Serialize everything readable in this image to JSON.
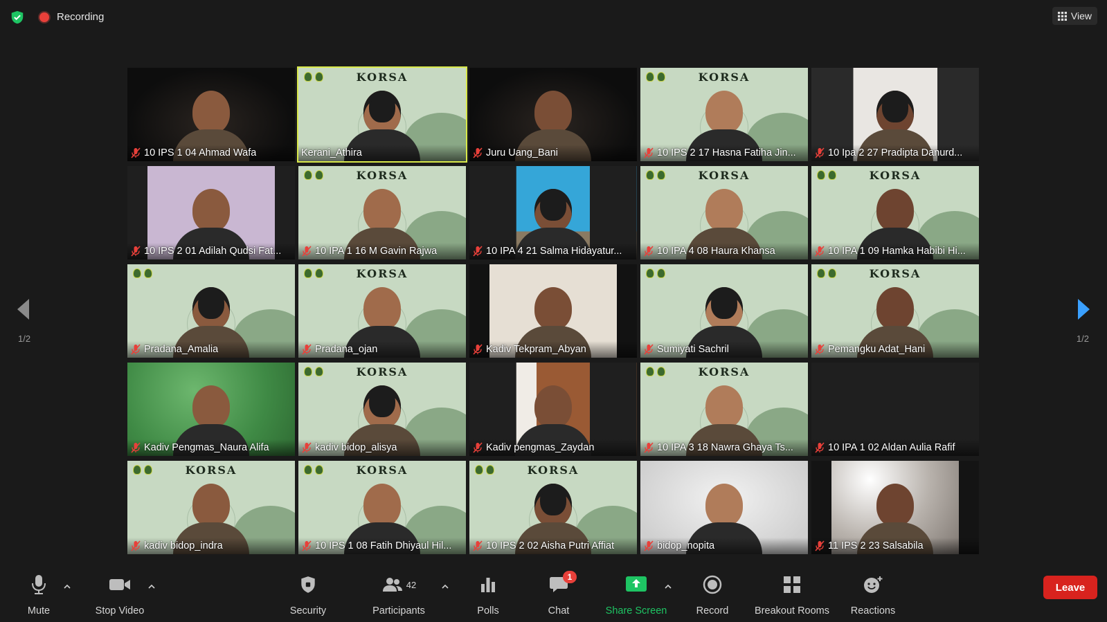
{
  "top": {
    "recording_label": "Recording",
    "view_label": "View"
  },
  "colors": {
    "accent_green": "#1ec463",
    "active_speaker": "#d8e84a",
    "leave_red": "#d8231e",
    "muted_red": "#e8403a"
  },
  "pager": {
    "left": "1/2",
    "right": "1/2"
  },
  "participants": [
    {
      "name": "10 IPS 1 04 Ahmad Wafa",
      "muted": true,
      "bg": "dark"
    },
    {
      "name": "Kerani_Athira",
      "muted": false,
      "bg": "korsa",
      "active": true,
      "banner": "KORSA"
    },
    {
      "name": "Juru Uang_Bani",
      "muted": true,
      "bg": "dark"
    },
    {
      "name": "10 IPS 2 17 Hasna Fatiha Jin...",
      "muted": true,
      "bg": "korsa",
      "banner": "KORSA"
    },
    {
      "name": "10 Ipa 2 27 Pradipta Danurd...",
      "muted": true,
      "bg": "room"
    },
    {
      "name": "10 IPS 2 01 Adilah Qudsi Fat...",
      "muted": true,
      "bg": "purple"
    },
    {
      "name": "10 IPA 1 16 M Gavin Rajwa",
      "muted": true,
      "bg": "korsa",
      "banner": "KORSA"
    },
    {
      "name": "10 IPA 4 21 Salma Hidayatur...",
      "muted": true,
      "bg": "blue"
    },
    {
      "name": "10 IPA 4 08 Haura Khansa",
      "muted": true,
      "bg": "korsa",
      "banner": "KORSA"
    },
    {
      "name": "10 IPA 1 09 Hamka Habibi Hi...",
      "muted": true,
      "bg": "korsa",
      "banner": "KORSA"
    },
    {
      "name": "Pradana_Amalia",
      "muted": true,
      "bg": "korsa",
      "banner": ""
    },
    {
      "name": "Pradana_ojan",
      "muted": true,
      "bg": "korsa",
      "banner": "KORSA"
    },
    {
      "name": "Kadiv Tekpram_Abyan",
      "muted": true,
      "bg": "wall"
    },
    {
      "name": "Sumiyati Sachril",
      "muted": true,
      "bg": "korsa",
      "banner": ""
    },
    {
      "name": "Pemangku Adat_Hani",
      "muted": true,
      "bg": "korsa",
      "banner": "KORSA"
    },
    {
      "name": "Kadiv Pengmas_Naura Alifa",
      "muted": true,
      "bg": "green"
    },
    {
      "name": "kadiv bidop_alisya",
      "muted": true,
      "bg": "korsa",
      "banner": "KORSA"
    },
    {
      "name": "Kadiv pengmas_Zaydan",
      "muted": true,
      "bg": "door"
    },
    {
      "name": "10 IPA 3 18 Nawra Ghaya Ts...",
      "muted": true,
      "bg": "korsa",
      "banner": "KORSA"
    },
    {
      "name": "10 IPA 1 02 Aldan Aulia Rafif",
      "muted": true,
      "bg": "empty"
    },
    {
      "name": "kadiv bidop_indra",
      "muted": true,
      "bg": "korsa",
      "banner": "KORSA"
    },
    {
      "name": "10 IPS 1 08 Fatih Dhiyaul Hil...",
      "muted": true,
      "bg": "korsa",
      "banner": "KORSA"
    },
    {
      "name": "10 IPS 2 02 Aisha Putri Affiat",
      "muted": true,
      "bg": "korsa",
      "banner": "KORSA"
    },
    {
      "name": "bidop_nopita",
      "muted": true,
      "bg": "white"
    },
    {
      "name": "11 IPS 2 23 Salsabila",
      "muted": true,
      "bg": "lamp"
    }
  ],
  "toolbar": {
    "mute_label": "Mute",
    "video_label": "Stop Video",
    "security_label": "Security",
    "participants_label": "Participants",
    "participants_count": "42",
    "polls_label": "Polls",
    "chat_label": "Chat",
    "chat_badge": "1",
    "share_label": "Share Screen",
    "record_label": "Record",
    "breakout_label": "Breakout Rooms",
    "reactions_label": "Reactions",
    "leave_label": "Leave"
  }
}
